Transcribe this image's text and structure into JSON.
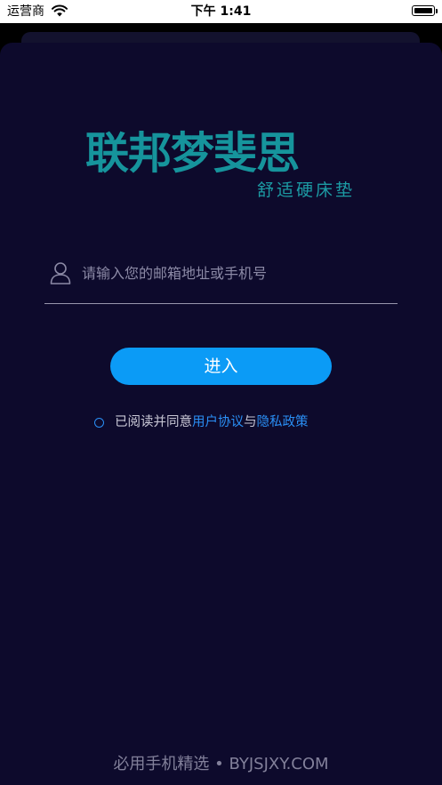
{
  "status_bar": {
    "carrier": "运营商",
    "time": "下午 1:41"
  },
  "brand": {
    "name": "联邦梦斐思",
    "tagline": "舒适硬床垫",
    "color": "#16949c"
  },
  "login": {
    "account_placeholder": "请输入您的邮箱地址或手机号",
    "account_value": "",
    "submit_label": "进入"
  },
  "agreement": {
    "prefix": "已阅读并同意",
    "user_agreement_link": "用户协议",
    "conjunction": "与",
    "privacy_policy_link": "隐私政策",
    "checked": false
  },
  "watermark": "必用手机精选 • BYJSJXY.COM",
  "colors": {
    "background": "#0d0a2c",
    "accent": "#0b9bf6",
    "link": "#2a8ff5"
  }
}
